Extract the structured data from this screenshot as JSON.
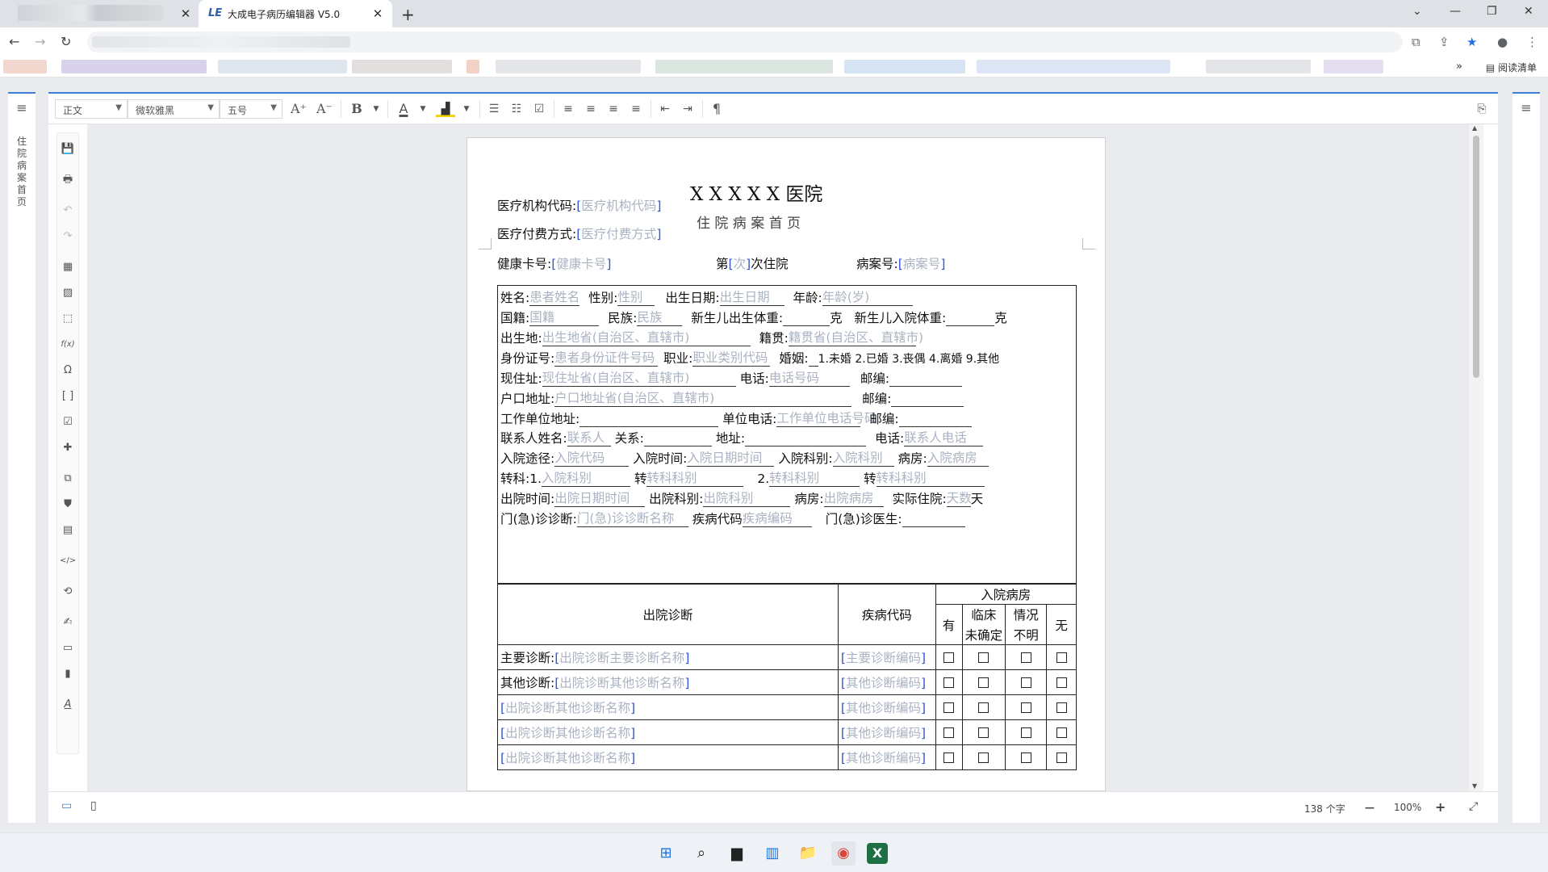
{
  "browser": {
    "tab_title": "大成电子病历编辑器 V5.0",
    "tab_favicon": "LE",
    "close_symbol": "✕",
    "newtab_symbol": "+",
    "reading_list": "阅读清单",
    "back": "←",
    "forward": "→",
    "reload": "↻",
    "win_chevron": "⌄",
    "win_min": "—",
    "win_max": "❐",
    "win_close": "✕",
    "translate": "⧉",
    "share": "⇪",
    "star": "★",
    "profile": "●",
    "more": "⋮",
    "bm_more": "»",
    "readlist_icon": "▤"
  },
  "editor": {
    "nav_title": "住院病案首页",
    "menu_icon": "≡",
    "toolbar": {
      "style_value": "正文",
      "font_value": "微软雅黑",
      "size_value": "五号",
      "caret": "▼",
      "grow": "A⁺",
      "shrink": "A⁻",
      "bold": "B",
      "fontcolor": "A",
      "highlight": "▟",
      "bullets": "☰",
      "numbering": "☷",
      "checkbox": "☑",
      "align_left": "≡",
      "align_center": "≡",
      "align_right": "≡",
      "justify": "≡",
      "indent_dec": "⇤",
      "indent_inc": "⇥",
      "pilcrow": "¶",
      "comment": "⎘"
    },
    "tools": [
      "💾",
      "🖶",
      "↶",
      "↷",
      "▦",
      "▨",
      "⬚",
      "f(x)",
      "Ω",
      "[ ]",
      "☑",
      "✚",
      "⧉",
      "⛊",
      "▤",
      "</>",
      "⟲",
      "✍",
      "▭",
      "▮",
      "A"
    ],
    "status": {
      "desktop_icon": "▭",
      "mobile_icon": "▯",
      "word_count": "138 个字",
      "zoom_out": "—",
      "zoom": "100%",
      "zoom_in": "+",
      "fullscreen": "⤢"
    }
  },
  "doc": {
    "hospital": "X X X X X 医院",
    "subtitle": "住 院 病 案 首 页",
    "org_code_label": "医疗机构代码:",
    "org_code": "医疗机构代码",
    "pay_label": "医疗付费方式:",
    "pay": "医疗付费方式",
    "lb": "[",
    "rb": "]",
    "card_label": "健康卡号:",
    "card": "健康卡号",
    "nth_prefix": "第",
    "nth": "次",
    "nth_suffix": "次住院",
    "case_label": "病案号:",
    "case": "病案号",
    "r1": {
      "name_l": "姓名:",
      "name": "患者姓名",
      "sex_l": "性别:",
      "sex": "性别",
      "dob_l": "出生日期:",
      "dob": "出生日期",
      "age_l": "年龄:",
      "age": "年龄(岁)"
    },
    "r2": {
      "nat_l": "国籍:",
      "nat": "国籍",
      "eth_l": "民族:",
      "eth": "民族",
      "nbw_l": "新生儿出生体重:",
      "g1": "克",
      "nbaw_l": "新生儿入院体重:",
      "g2": "克"
    },
    "r3": {
      "bp_l": "出生地:",
      "bp": "出生地省(自治区、直辖市)",
      "nat2_l": "籍贯:",
      "nat2": "籍贯省(自治区、直辖市)"
    },
    "r4": {
      "id_l": "身份证号:",
      "id": "患者身份证件号码",
      "job_l": "职业:",
      "job": "职业类别代码",
      "mar_l": "婚姻:",
      "mar": "1.未婚 2.已婚 3.丧偶 4.离婚 9.其他"
    },
    "r5": {
      "addr_l": "现住址:",
      "addr": "现住址省(自治区、直辖市)",
      "tel_l": "电话:",
      "tel": "电话号码",
      "zip_l": "邮编:"
    },
    "r6": {
      "hk_l": "户口地址:",
      "hk": "户口地址省(自治区、直辖市)",
      "zip_l": "邮编:"
    },
    "r7": {
      "work_l": "工作单位地址:",
      "wtel_l": "单位电话:",
      "wtel": "工作单位电话号码",
      "zip_l": "邮编:"
    },
    "r8": {
      "ct_l": "联系人姓名:",
      "ct": "联系人",
      "rel_l": "关系:",
      "ad_l": "地址:",
      "ctel_l": "电话:",
      "ctel": "联系人电话"
    },
    "r9": {
      "way_l": "入院途径:",
      "way": "入院代码",
      "time_l": "入院时间:",
      "time": "入院日期时间",
      "dept_l": "入院科别:",
      "dept": "入院科别",
      "ward_l": "病房:",
      "ward": "入院病房"
    },
    "r10": {
      "tr_l": "转科:",
      "n1": "1.",
      "d1": "入院科别",
      "z1": "转",
      "t1": "转科科别",
      "n2": "2.",
      "d2": "转科科别",
      "z2": "转",
      "t2": "转科科别"
    },
    "r11": {
      "ot_l": "出院时间:",
      "ot": "出院日期时间",
      "od_l": "出院科别:",
      "od": "出院科别",
      "ow_l": "病房:",
      "ow": "出院病房",
      "days_l": "实际住院:",
      "days": "天数",
      "days_u": "天"
    },
    "r12": {
      "er_l": "门(急)诊诊断:",
      "er": "门(急)诊诊断名称",
      "code_l": "疾病代码",
      "code": "疾病编码",
      "doc_l": "门(急)诊医生:"
    },
    "table": {
      "h_diag": "出院诊断",
      "h_code": "疾病代码",
      "h_cond": "入院病房",
      "h_yes": "有",
      "h_clin1": "临床",
      "h_clin2": "未确定",
      "h_unk1": "情况",
      "h_unk2": "不明",
      "h_no": "无",
      "rows": [
        {
          "label": "主要诊断:",
          "diag": "出院诊断主要诊断名称",
          "code": "主要诊断编码"
        },
        {
          "label": "其他诊断:",
          "diag": "出院诊断其他诊断名称",
          "code": "其他诊断编码"
        },
        {
          "label": "",
          "diag": "出院诊断其他诊断名称",
          "code": "其他诊断编码"
        },
        {
          "label": "",
          "diag": "出院诊断其他诊断名称",
          "code": "其他诊断编码"
        },
        {
          "label": "",
          "diag": "出院诊断其他诊断名称",
          "code": "其他诊断编码"
        }
      ]
    }
  },
  "taskbar": [
    "⊞",
    "⌕",
    "▆",
    "▥",
    "📁",
    "◉",
    "X"
  ]
}
